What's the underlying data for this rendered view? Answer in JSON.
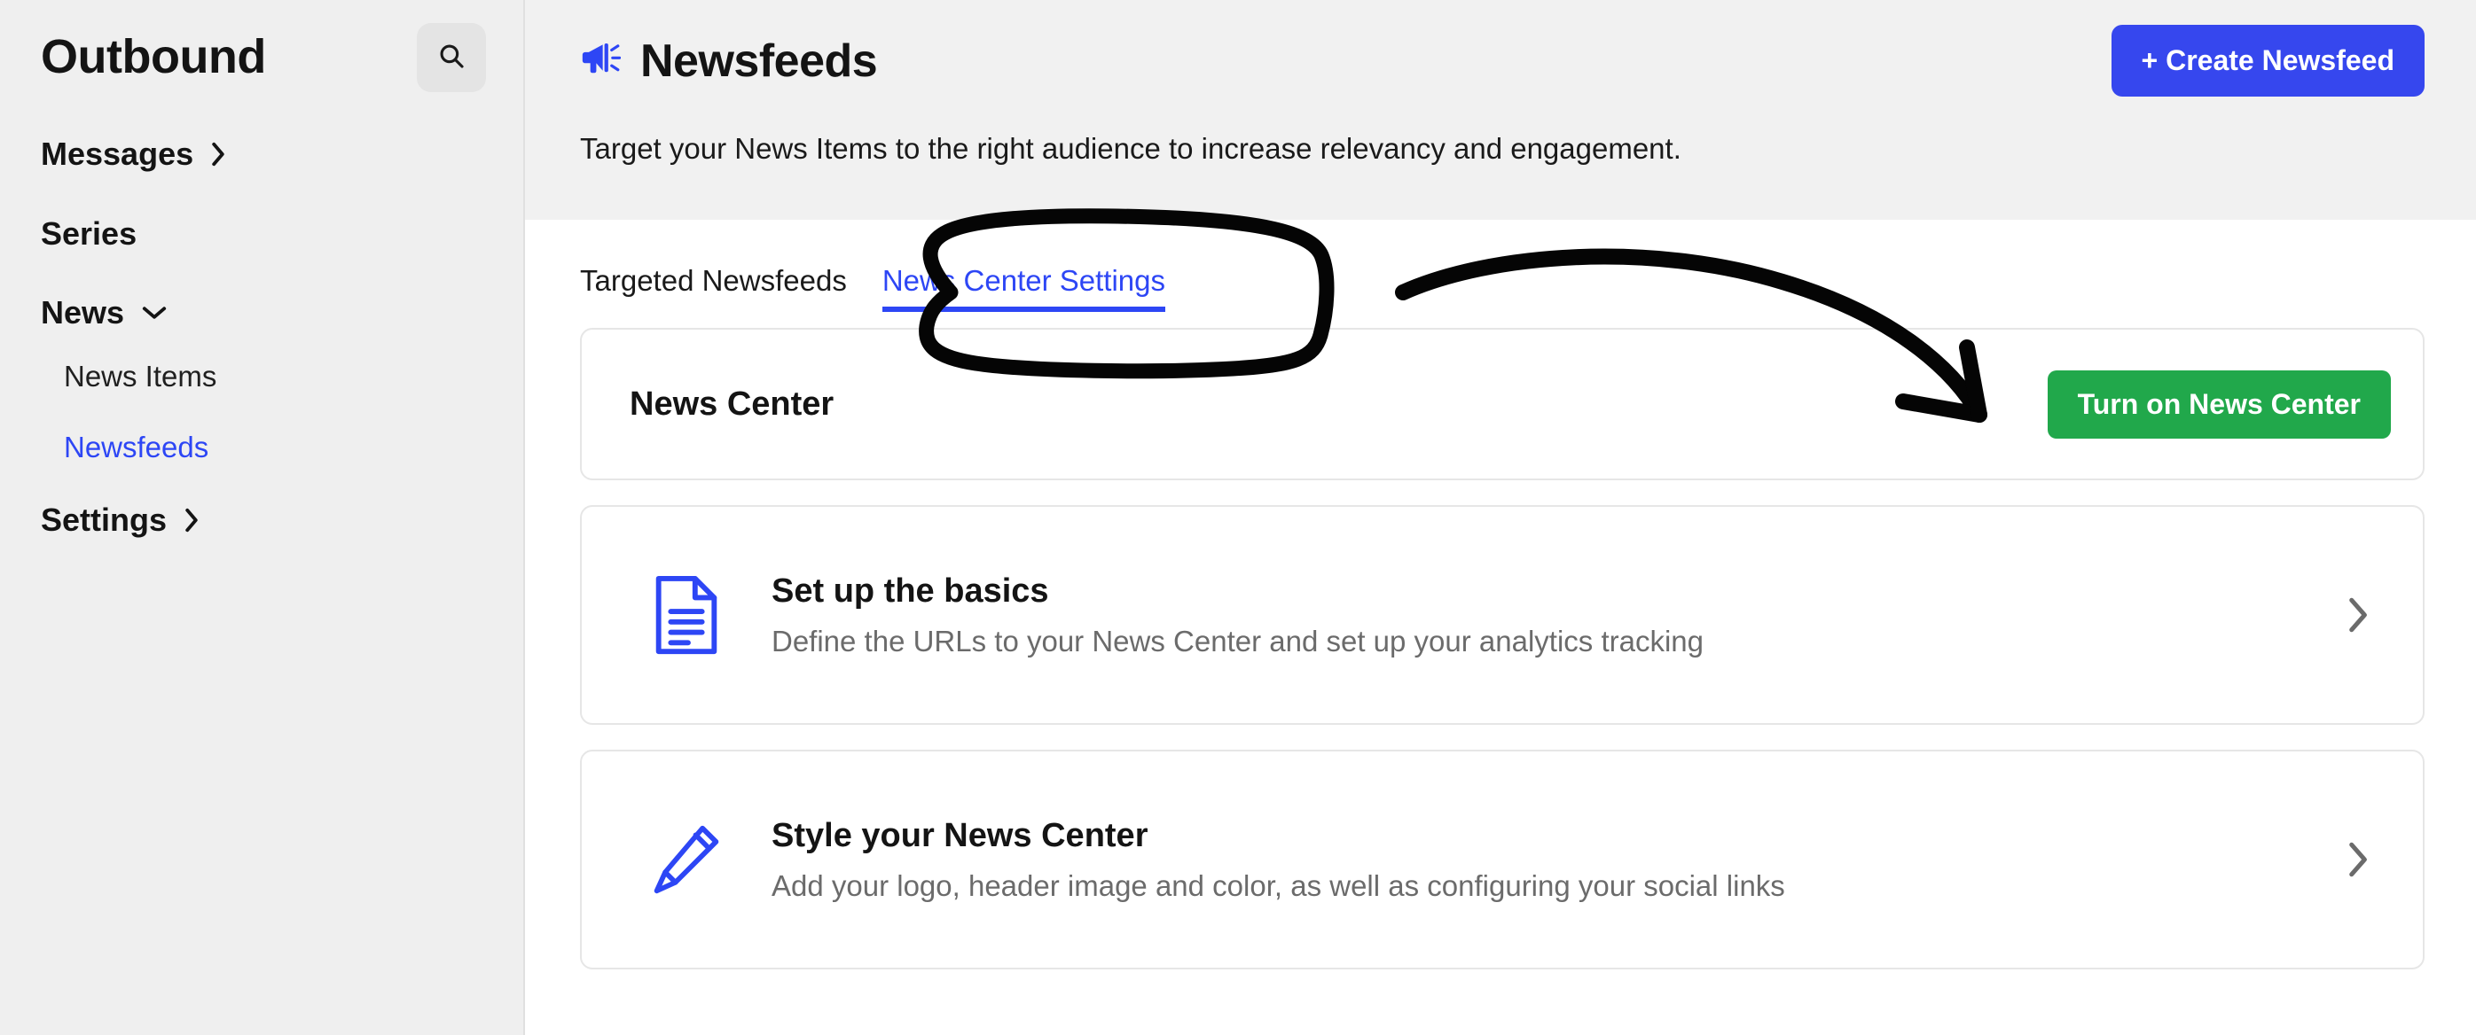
{
  "sidebar": {
    "brand": "Outbound",
    "search_icon": "search-icon",
    "items": [
      {
        "label": "Messages",
        "icon": "chevron-right-icon",
        "type": "expandable",
        "active": false
      },
      {
        "label": "Series",
        "icon": "",
        "type": "plain",
        "active": false
      },
      {
        "label": "News",
        "icon": "chevron-down-icon",
        "type": "expanded",
        "active": false
      }
    ],
    "news_subitems": [
      {
        "label": "News Items",
        "active": false
      },
      {
        "label": "Newsfeeds",
        "active": true
      }
    ],
    "footer_items": [
      {
        "label": "Settings",
        "icon": "chevron-right-icon",
        "type": "expandable",
        "active": false
      }
    ]
  },
  "header": {
    "icon": "megaphone-icon",
    "title": "Newsfeeds",
    "create_button": "+ Create Newsfeed",
    "subtitle": "Target your News Items to the right audience to increase relevancy and engagement."
  },
  "tabs": [
    {
      "label": "Targeted Newsfeeds",
      "active": false
    },
    {
      "label": "News Center Settings",
      "active": true
    }
  ],
  "news_center_card": {
    "heading": "News Center",
    "button": "Turn on News Center"
  },
  "setting_cards": [
    {
      "icon": "document-icon",
      "title": "Set up the basics",
      "description": "Define the URLs to your News Center and set up your analytics tracking",
      "chevron": "chevron-right-icon"
    },
    {
      "icon": "pencil-icon",
      "title": "Style your News Center",
      "description": "Add your logo, header image and color, as well as configuring your social links",
      "chevron": "chevron-right-icon"
    }
  ],
  "annotations": {
    "circle_target": "News Center Settings",
    "arrow_target": "Turn on News Center",
    "ink_color": "#050505"
  },
  "colors": {
    "accent_blue": "#2d46f5",
    "button_blue": "#3647ee",
    "success_green": "#21a84b",
    "sidebar_bg": "#efefef",
    "header_bg": "#f1f1f1",
    "text_dark": "#141414",
    "text_muted": "#6b6b6b"
  }
}
